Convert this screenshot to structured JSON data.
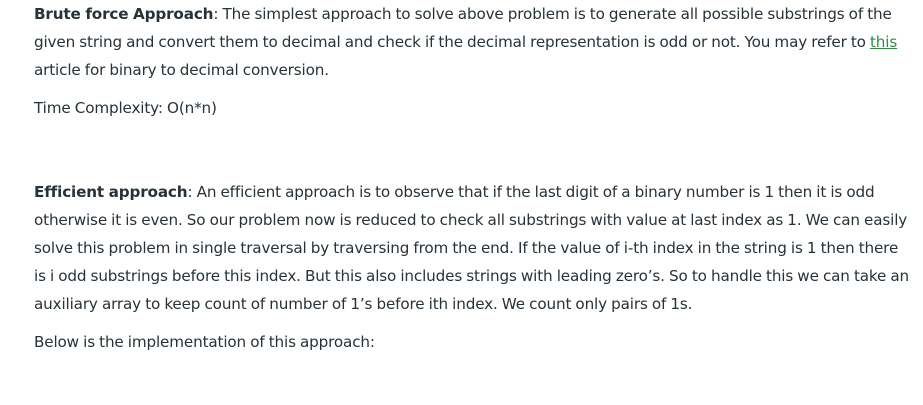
{
  "brute": {
    "heading": "Brute force Approach",
    "text_before_link": ": The simplest approach to solve above problem is to generate all possible substrings of the given string and convert them to decimal and check if the decimal representation is odd or not. You may refer to ",
    "link_text": "this",
    "text_after_link": " article for binary to decimal conversion."
  },
  "complexity": {
    "text": "Time Complexity: O(n*n)"
  },
  "efficient": {
    "heading": "Efficient approach",
    "text": ": An efficient approach is to observe that if the last digit of a binary number is 1 then it is odd otherwise it is even. So our problem now is reduced to check all substrings with value at last index as 1. We can easily solve this problem in single traversal by traversing from the end. If the value of i-th index in the string is 1 then there is i odd substrings before this index. But this also includes strings with leading zero’s. So to handle this we can take an auxiliary array to keep count of number of 1’s before ith index. We count only pairs of 1s."
  },
  "implementation": {
    "text": "Below is the implementation of this approach:"
  },
  "colors": {
    "text": "#273239",
    "link": "#2f8d46",
    "background": "#ffffff"
  }
}
